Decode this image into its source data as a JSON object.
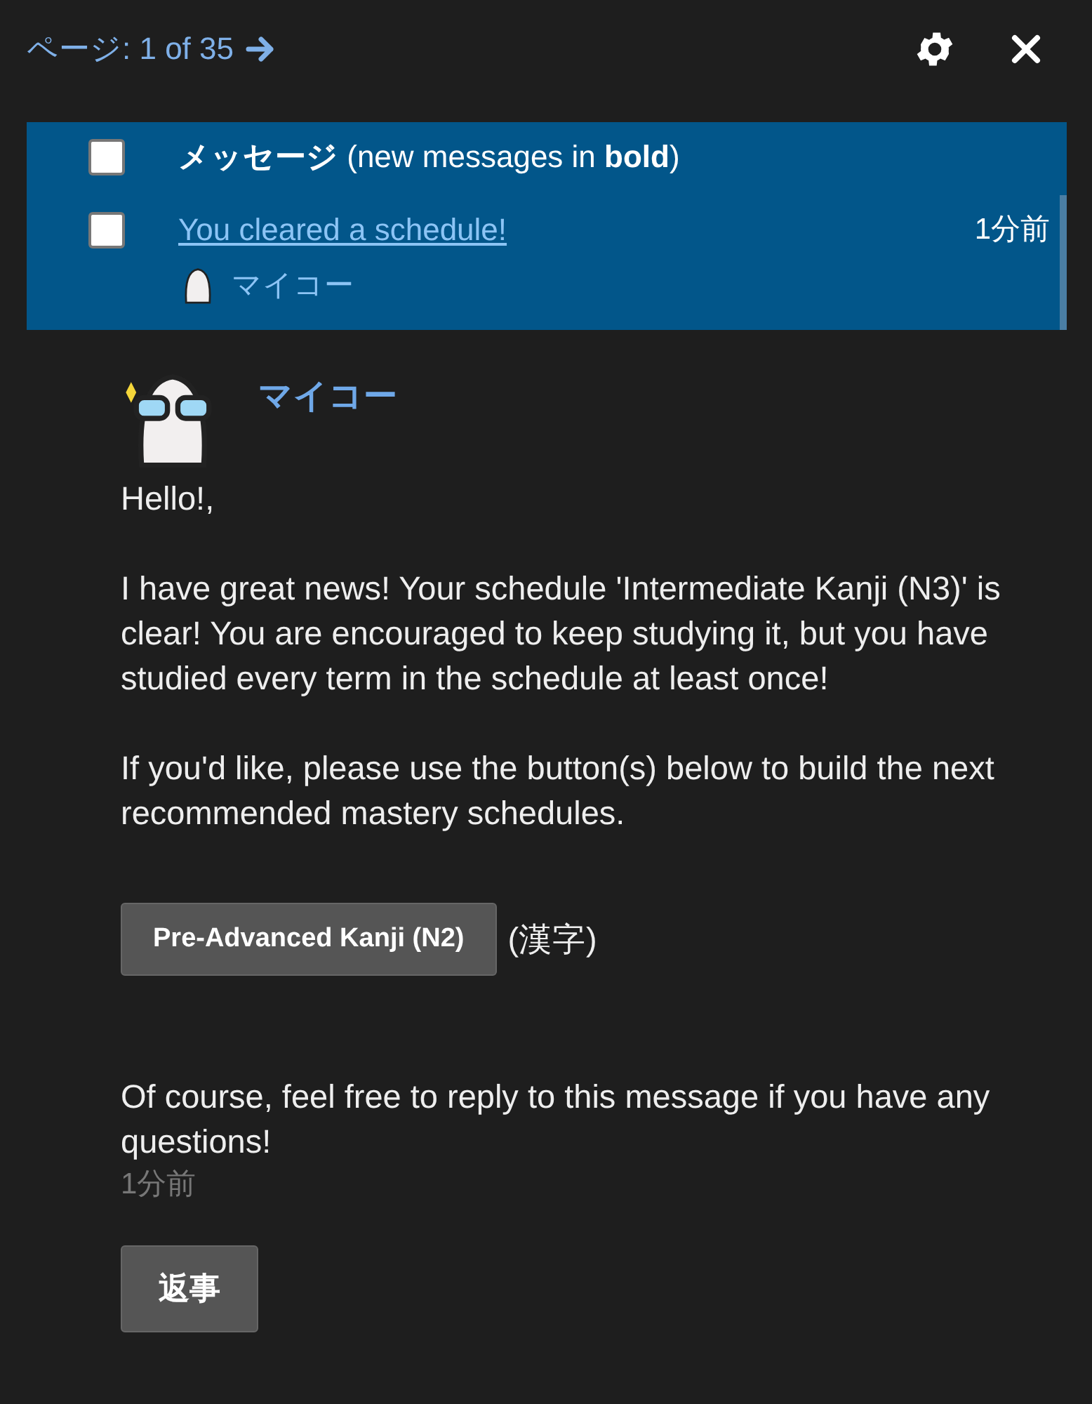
{
  "header": {
    "page_label": "ページ: 1 of 35"
  },
  "message_list": {
    "title": "**メッセージ** (new messages in **bold**)",
    "checked": false,
    "messages": [
      {
        "subject": "You cleared a schedule!",
        "unread": false,
        "time": "1分前",
        "sender": "マイコー",
        "checked": false
      }
    ]
  },
  "message": {
    "sender": "マイコー",
    "paragraphs": [
      "Hello!,",
      "I have great news! Your schedule 'Intermediate Kanji (N3)' is clear! You are encouraged to keep studying it, but you have studied every term in the schedule at least once!",
      "If you'd like, please use the button(s) below to build the next recommended mastery schedules."
    ],
    "schedule_buttons": [
      {
        "label": "Pre-Advanced Kanji (N2)",
        "note": "(漢字)"
      }
    ],
    "closing": "Of course, feel free to reply to this message if you have any questions!",
    "time": "1分前",
    "reply_button": "返事"
  }
}
